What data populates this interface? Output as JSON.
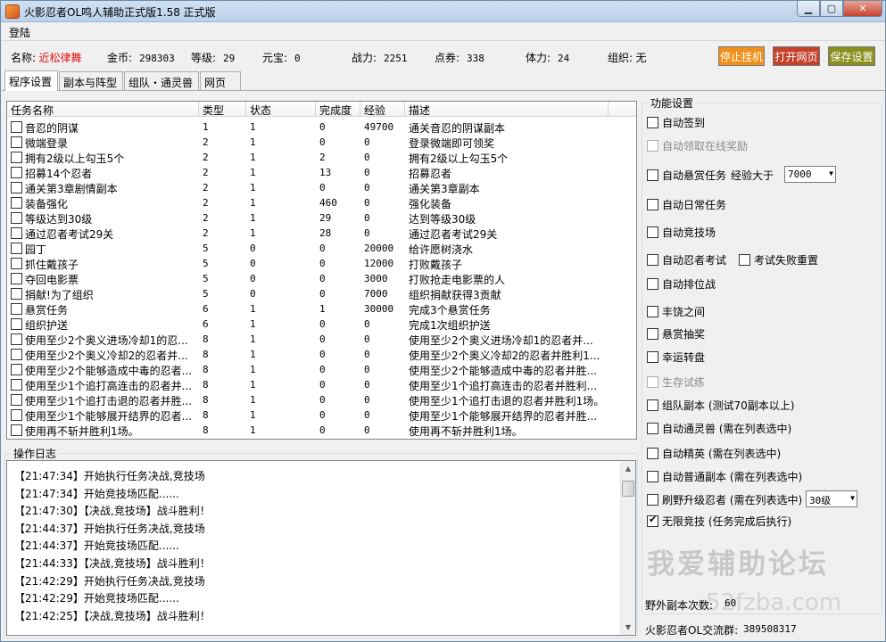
{
  "window": {
    "title": "火影忍者OL鸣人辅助正式版1.58 正式版"
  },
  "menu": {
    "login": "登陆"
  },
  "info": {
    "name_label": "名称:",
    "name_value": "近松律舞",
    "gold_label": "金币:",
    "gold_value": "298303",
    "level_label": "等级:",
    "level_value": "29",
    "yuanbao_label": "元宝:",
    "yuanbao_value": "0",
    "power_label": "战力:",
    "power_value": "2251",
    "coupon_label": "点券:",
    "coupon_value": "338",
    "stamina_label": "体力:",
    "stamina_value": "24",
    "org_label": "组织:",
    "org_value": "无"
  },
  "buttons": {
    "stop": "停止挂机",
    "open_web": "打开网页",
    "save": "保存设置"
  },
  "colors": {
    "stop": "#f0901c",
    "open_web": "#c4412a",
    "save": "#8a8f1f"
  },
  "tabs": [
    "程序设置",
    "副本与阵型",
    "组队・通灵兽",
    "网页"
  ],
  "task_list": {
    "columns": [
      "任务名称",
      "类型",
      "状态",
      "完成度",
      "经验",
      "描述"
    ],
    "rows": [
      [
        "音忍的阴谋",
        "1",
        "1",
        "0",
        "49700",
        "通关音忍的阴谋副本"
      ],
      [
        "微端登录",
        "2",
        "1",
        "0",
        "0",
        "登录微端即可领奖"
      ],
      [
        "拥有2级以上勾玉5个",
        "2",
        "1",
        "2",
        "0",
        "拥有2级以上勾玉5个"
      ],
      [
        "招募14个忍者",
        "2",
        "1",
        "13",
        "0",
        "招募忍者"
      ],
      [
        "通关第3章剧情副本",
        "2",
        "1",
        "0",
        "0",
        "通关第3章副本"
      ],
      [
        "装备强化",
        "2",
        "1",
        "460",
        "0",
        "强化装备"
      ],
      [
        "等级达到30级",
        "2",
        "1",
        "29",
        "0",
        "达到等级30级"
      ],
      [
        "通过忍者考试29关",
        "2",
        "1",
        "28",
        "0",
        "通过忍者考试29关"
      ],
      [
        "园丁",
        "5",
        "0",
        "0",
        "20000",
        "给许愿树浇水"
      ],
      [
        "抓住戴孩子",
        "5",
        "0",
        "0",
        "12000",
        "打败戴孩子"
      ],
      [
        "夺回电影票",
        "5",
        "0",
        "0",
        "3000",
        "打败抢走电影票的人"
      ],
      [
        "捐献!为了组织",
        "5",
        "0",
        "0",
        "7000",
        "组织捐献获得3贡献"
      ],
      [
        "悬赏任务",
        "6",
        "1",
        "1",
        "30000",
        "完成3个悬赏任务"
      ],
      [
        "组织护送",
        "6",
        "1",
        "0",
        "0",
        "完成1次组织护送"
      ],
      [
        "使用至少2个奥义进场冷却1的忍...",
        "8",
        "1",
        "0",
        "0",
        "使用至少2个奥义进场冷却1的忍者并..."
      ],
      [
        "使用至少2个奥义冷却2的忍者并...",
        "8",
        "1",
        "0",
        "0",
        "使用至少2个奥义冷却2的忍者并胜利1..."
      ],
      [
        "使用至少2个能够造成中毒的忍者...",
        "8",
        "1",
        "0",
        "0",
        "使用至少2个能够造成中毒的忍者并胜..."
      ],
      [
        "使用至少1个追打高连击的忍者并...",
        "8",
        "1",
        "0",
        "0",
        "使用至少1个追打高连击的忍者并胜利..."
      ],
      [
        "使用至少1个追打击退的忍者并胜...",
        "8",
        "1",
        "0",
        "0",
        "使用至少1个追打击退的忍者并胜利1场。"
      ],
      [
        "使用至少1个能够展开结界的忍者...",
        "8",
        "1",
        "0",
        "0",
        "使用至少1个能够展开结界的忍者并胜..."
      ],
      [
        "使用再不斩并胜利1场。",
        "8",
        "1",
        "0",
        "0",
        "使用再不斩并胜利1场。"
      ]
    ]
  },
  "log": {
    "title": "操作日志",
    "lines": [
      "【21:47:34】开始执行任务决战,竞技场",
      "【21:47:34】开始竞技场匹配......",
      "【21:47:30】【决战,竞技场】战斗胜利！",
      "【21:44:37】开始执行任务决战,竞技场",
      "【21:44:37】开始竞技场匹配......",
      "【21:44:33】【决战,竞技场】战斗胜利！",
      "【21:42:29】开始执行任务决战,竞技场",
      "【21:42:29】开始竞技场匹配......",
      "【21:42:25】【决战,竞技场】战斗胜利！"
    ]
  },
  "settings": {
    "title": "功能设置",
    "auto_signin": "自动签到",
    "auto_online_reward": "自动领取在线奖励",
    "auto_bounty": "自动悬赏任务",
    "exp_over": "经验大于",
    "exp_value": "7000",
    "auto_daily": "自动日常任务",
    "auto_arena": "自动竞技场",
    "auto_exam": "自动忍者考试",
    "exam_reset": "考试失败重置",
    "auto_rank": "自动排位战",
    "feast": "丰饶之间",
    "bounty_draw": "悬赏抽奖",
    "wheel": "幸运转盘",
    "survival": "生存试练",
    "team_dungeon": "组队副本 (测试70副本以上)",
    "auto_summon": "自动通灵兽 (需在列表选中)",
    "auto_elite": "自动精英 (需在列表选中)",
    "auto_normal": "自动普通副本 (需在列表选中)",
    "wild_level": "刷野升级忍者 (需在列表选中)",
    "wild_level_value": "30级",
    "infinite_arena": "无限竞技 (任务完成后执行)",
    "wild_count_label": "野外副本次数:",
    "wild_count_value": "60",
    "group_label": "火影忍者OL交流群:",
    "group_value": "389508317"
  },
  "watermark": {
    "main": "我爱辅助论坛",
    "url": "52fzba.com"
  }
}
